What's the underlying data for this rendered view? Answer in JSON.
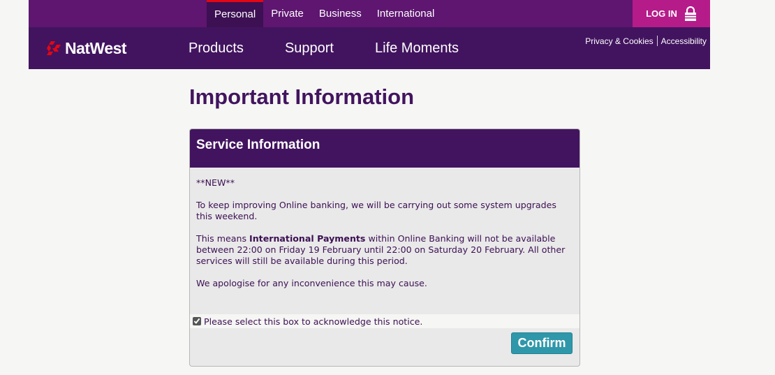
{
  "header": {
    "segments": [
      "Personal",
      "Private",
      "Business",
      "International"
    ],
    "active_segment": "Personal",
    "login_label": "LOG IN",
    "brand": "NatWest",
    "main_nav": [
      "Products",
      "Support",
      "Life Moments"
    ],
    "utility": {
      "privacy": "Privacy & Cookies",
      "accessibility": "Accessibility"
    },
    "colors": {
      "topbar": "#5e1670",
      "mainbar": "#42145f",
      "login": "#b51c89",
      "active_indicator": "#e30613"
    }
  },
  "page": {
    "title": "Important Information"
  },
  "panel": {
    "title": "Service Information",
    "new_tag": "**NEW**",
    "para1": "To keep improving Online banking, we will be carrying out some system upgrades this weekend.",
    "para2_pre": "This means ",
    "para2_bold": "International Payments",
    "para2_post": " within Online Banking will not be available between 22:00 on Friday 19 February until 22:00 on Saturday 20 February. All other services will still be available during this period.",
    "para3": "We apologise for any inconvenience this may cause.",
    "acknowledge_label": "Please select this box to acknowledge this notice.",
    "acknowledge_checked": true,
    "confirm_label": "Confirm",
    "confirm_color": "#2f97aa"
  },
  "icons": [
    "lock-icon",
    "natwest-logo-icon",
    "checkbox"
  ]
}
